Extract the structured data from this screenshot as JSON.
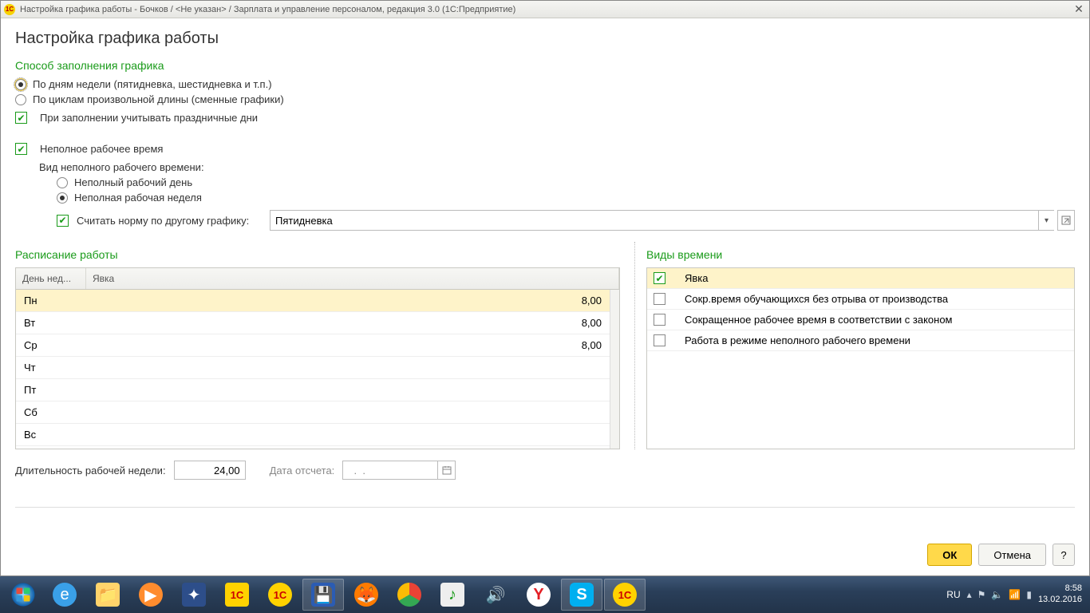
{
  "titlebar": "Настройка графика работы - Бочков / <Не указан> / Зарплата и управление персоналом, редакция 3.0  (1С:Предприятие)",
  "page_title": "Настройка графика работы",
  "s_fill": "Способ заполнения графика",
  "r_bydays": "По дням недели (пятидневка, шестидневка и т.п.)",
  "r_bycycle": "По циклам произвольной длины (сменные графики)",
  "cb_holidays": "При заполнении учитывать праздничные дни",
  "cb_parttime": "Неполное рабочее время",
  "lbl_ptkind": "Вид неполного рабочего времени:",
  "r_ptday": "Неполный рабочий день",
  "r_ptweek": "Неполная рабочая неделя",
  "cb_othernorm": "Считать норму по другому графику:",
  "other_schedule": "Пятидневка",
  "s_schedule": "Расписание работы",
  "sched_cols": {
    "day": "День нед...",
    "att": "Явка"
  },
  "sched_rows": [
    {
      "day": "Пн",
      "val": "8,00",
      "sel": true
    },
    {
      "day": "Вт",
      "val": "8,00"
    },
    {
      "day": "Ср",
      "val": "8,00"
    },
    {
      "day": "Чт",
      "val": ""
    },
    {
      "day": "Пт",
      "val": ""
    },
    {
      "day": "Сб",
      "val": ""
    },
    {
      "day": "Вс",
      "val": ""
    }
  ],
  "s_timetypes": "Виды времени",
  "tt_rows": [
    {
      "label": "Явка",
      "checked": true,
      "sel": true
    },
    {
      "label": "Сокр.время обучающихся без отрыва от производства",
      "checked": false
    },
    {
      "label": "Сокращенное рабочее время в соответствии с законом",
      "checked": false
    },
    {
      "label": "Работа в режиме неполного рабочего времени",
      "checked": false
    }
  ],
  "lbl_weeklen": "Длительность рабочей недели:",
  "weeklen": "24,00",
  "lbl_startdate": "Дата отсчета:",
  "startdate": "  .  .    ",
  "btn_ok": "ОК",
  "btn_cancel": "Отмена",
  "btn_help": "?",
  "tray": {
    "lang": "RU",
    "time": "8:58",
    "date": "13.02.2016"
  }
}
